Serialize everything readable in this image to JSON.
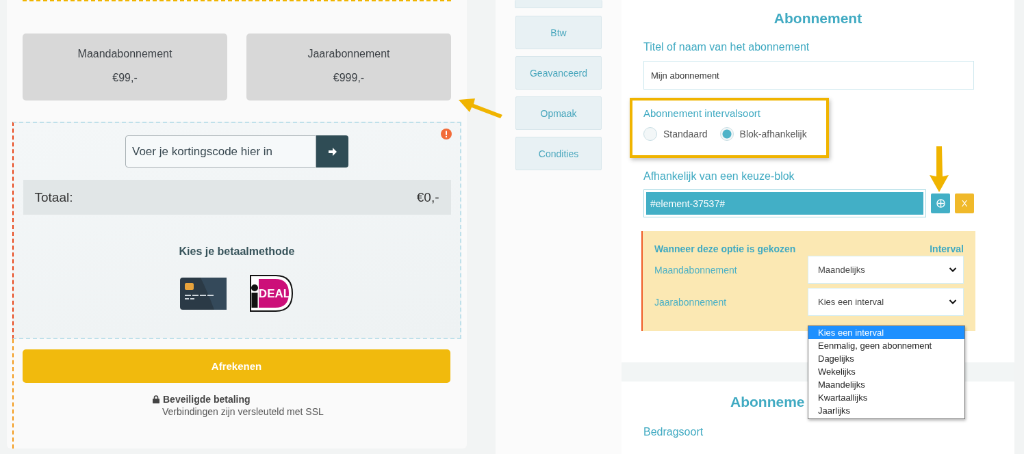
{
  "plans": [
    {
      "name": "Maandabonnement",
      "price": "€99,-"
    },
    {
      "name": "Jaarabonnement",
      "price": "€999,-"
    }
  ],
  "coupon": {
    "placeholder": "Voer je kortingscode hier in"
  },
  "total": {
    "label": "Totaal:",
    "value": "€0,-"
  },
  "payment": {
    "title": "Kies je betaalmethode",
    "methods": [
      {
        "kind": "card"
      },
      {
        "kind": "ideal",
        "label": "DEAL"
      }
    ]
  },
  "checkout": {
    "button": "Afrekenen",
    "secure_title": "Beveiligde betaling",
    "secure_note": "Verbindingen zijn versleuteld met SSL"
  },
  "tabs": [
    {
      "label": "Btw"
    },
    {
      "label": "Geavanceerd"
    },
    {
      "label": "Opmaak"
    },
    {
      "label": "Condities"
    }
  ],
  "form": {
    "title": "Abonnement",
    "name_label": "Titel of naam van het abonnement",
    "name_value": "Mijn abonnement",
    "interval": {
      "label": "Abonnement intervalsoort",
      "options": [
        {
          "label": "Standaard",
          "selected": false
        },
        {
          "label": "Blok-afhankelijk",
          "selected": true
        }
      ]
    },
    "dependency": {
      "label": "Afhankelijk van een keuze-blok",
      "value": "#element-37537#",
      "clear": "X"
    },
    "conditions": {
      "header_option": "Wanneer deze optie is gekozen",
      "header_interval": "Interval",
      "rows": [
        {
          "option": "Maandabonnement",
          "value": "Maandelijks"
        },
        {
          "option": "Jaarabonnement",
          "value": "Kies een interval"
        }
      ]
    },
    "dropdown": {
      "options": [
        {
          "label": "Kies een interval",
          "selected": true
        },
        {
          "label": "Eenmalig, geen abonnement",
          "selected": false
        },
        {
          "label": "Dagelijks",
          "selected": false
        },
        {
          "label": "Wekelijks",
          "selected": false
        },
        {
          "label": "Maandelijks",
          "selected": false
        },
        {
          "label": "Kwartaallijks",
          "selected": false
        },
        {
          "label": "Jaarlijks",
          "selected": false
        }
      ]
    }
  },
  "next_card": {
    "title": "Abonneme",
    "label": "Bedragsoort"
  }
}
